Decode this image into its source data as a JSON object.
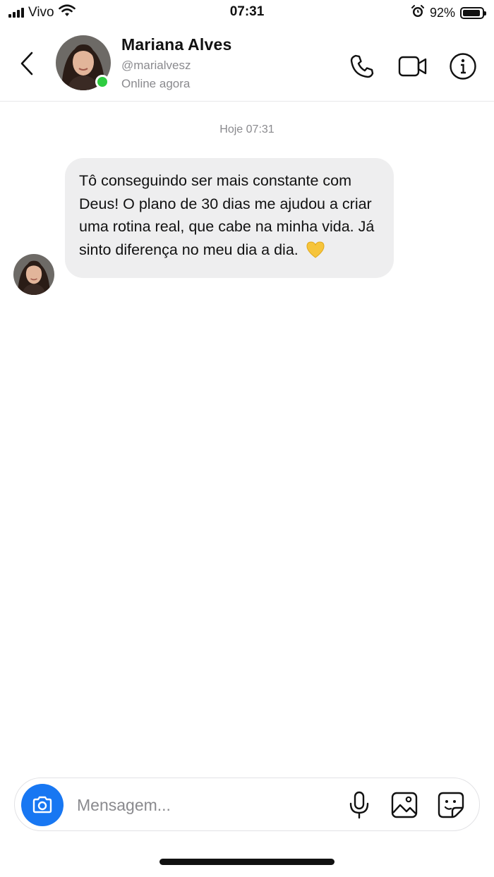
{
  "status_bar": {
    "carrier": "Vivo",
    "time": "07:31",
    "battery_percent": "92%",
    "battery_level": 0.92,
    "icons": [
      "signal-icon",
      "wifi-icon",
      "alarm-icon",
      "battery-icon"
    ]
  },
  "header": {
    "contact_name": "Mariana Alves",
    "handle": "@marialvesz",
    "status": "Online agora",
    "online_color": "#2ecc40",
    "icons": [
      "back-icon",
      "phone-icon",
      "video-icon",
      "info-icon"
    ]
  },
  "chat": {
    "timestamp": "Hoje 07:31",
    "messages": [
      {
        "sender": "Mariana Alves",
        "text": "Tô conseguindo ser mais constante com Deus! O plano de 30 dias me ajudou a criar uma rotina real, que cabe na minha vida. Já sinto diferença no meu dia a dia.",
        "emoji": "yellow-heart"
      }
    ]
  },
  "composer": {
    "placeholder": "Mensagem...",
    "accent_color": "#1877f2",
    "icons": [
      "camera-icon",
      "microphone-icon",
      "image-icon",
      "sticker-icon"
    ]
  }
}
